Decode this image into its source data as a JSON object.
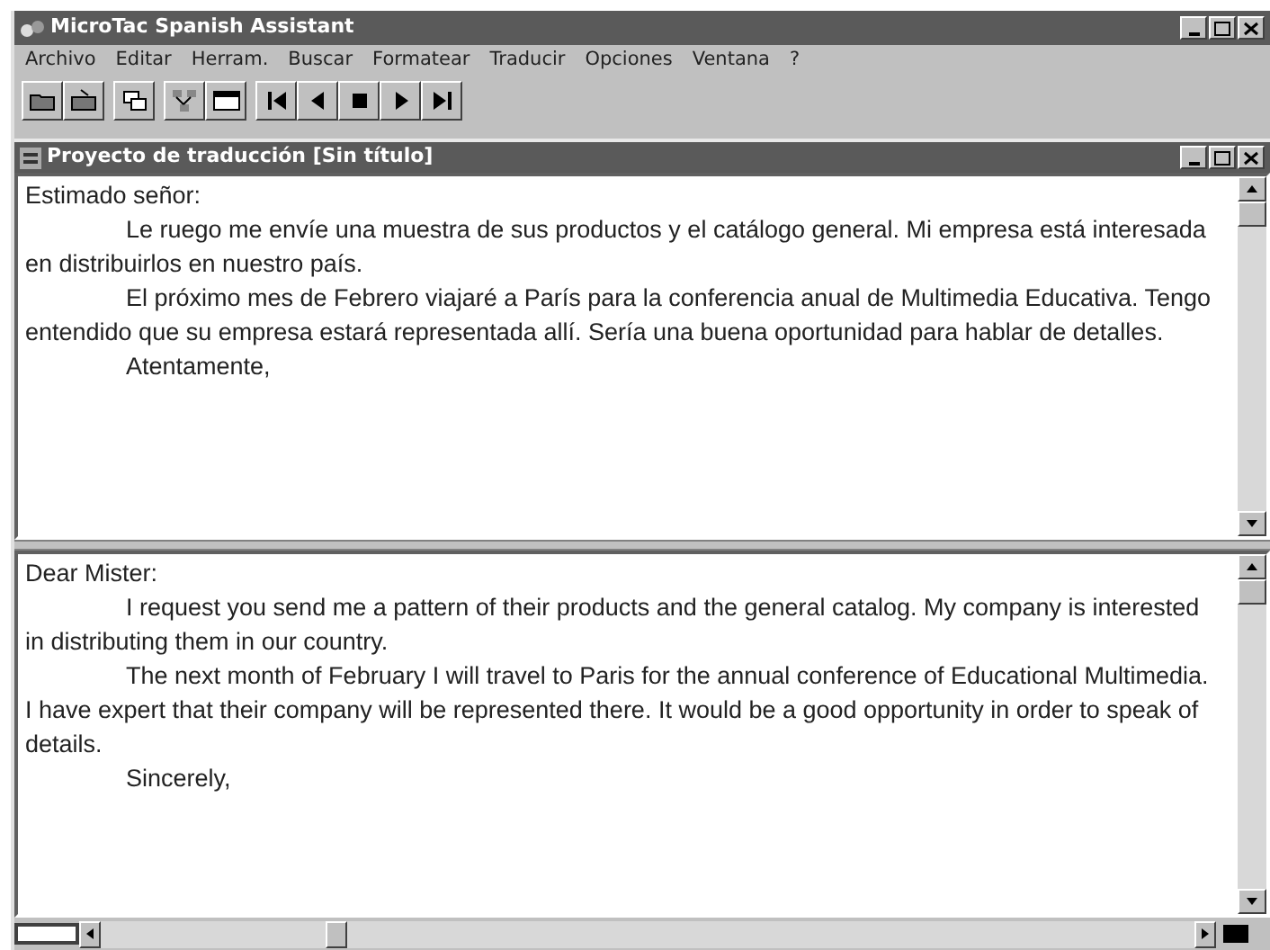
{
  "window": {
    "title": "MicroTac Spanish Assistant"
  },
  "menu": [
    "Archivo",
    "Editar",
    "Herram.",
    "Buscar",
    "Formatear",
    "Traducir",
    "Opciones",
    "Ventana",
    "?"
  ],
  "document": {
    "title": "Proyecto de traducción [Sin título]",
    "source": {
      "greeting": "Estimado señor:",
      "paragraphs": [
        "Le ruego me envíe una muestra de sus productos y el catálogo general. Mi empresa está interesada en distribuirlos en nuestro país.",
        "El próximo mes de Febrero viajaré a París para la conferencia anual de Multimedia Educativa. Tengo entendido que su empresa estará representada allí. Sería una buena oportunidad para hablar de detalles.",
        "Atentamente,"
      ]
    },
    "translation": {
      "greeting": "Dear Mister:",
      "paragraphs": [
        "I request you  send me a pattern of their products and the general catalog. My company is interested in distributing them in our country.",
        "The next month of February I will travel to Paris for the annual conference of Educational Multimedia. I have expert that their company will be represented there. It would be a good opportunity in order to speak of details.",
        "Sincerely,"
      ]
    }
  }
}
